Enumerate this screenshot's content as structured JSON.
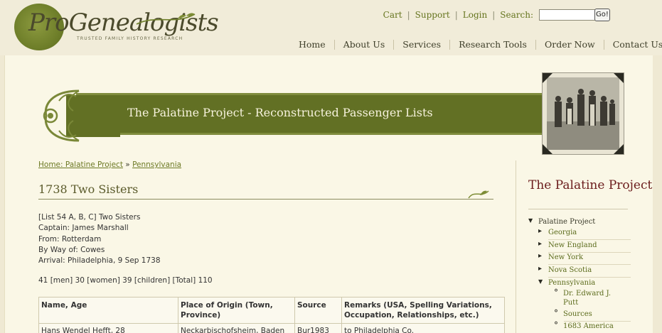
{
  "logo": {
    "script": "ProGenealogists",
    "tagline": "TRUSTED FAMILY HISTORY RESEARCH"
  },
  "util_nav": {
    "cart": "Cart",
    "support": "Support",
    "login": "Login",
    "search_label": "Search:",
    "search_value": "",
    "go": "Go!"
  },
  "main_nav": [
    "Home",
    "About Us",
    "Services",
    "Research Tools",
    "Order Now",
    "Contact Us"
  ],
  "banner": {
    "title": "The Palatine Project - Reconstructed Passenger Lists"
  },
  "breadcrumb": {
    "home": "Home: Palatine Project",
    "sep": "»",
    "current": "Pennsylvania"
  },
  "page": {
    "title": "1738 Two Sisters",
    "info": [
      "[List 54 A, B, C] Two Sisters",
      "Captain: James Marshall",
      "From: Rotterdam",
      "By Way of: Cowes",
      "Arrival: Philadelphia, 9 Sep 1738"
    ],
    "counts": "41 [men] 30 [women] 39 [children] [Total] 110"
  },
  "table": {
    "headers": [
      "Name, Age",
      "Place of Origin (Town, Province)",
      "Source",
      "Remarks (USA, Spelling Variations, Occupation, Relationships, etc.)"
    ],
    "rows": [
      [
        "Hans Wendel Hefft, 28",
        "Neckarbischofsheim, Baden",
        "Bur1983",
        "to Philadelphia Co."
      ]
    ]
  },
  "sidebar": {
    "title": "The Palatine Project",
    "items": [
      {
        "label": "Palatine Project",
        "level": 0,
        "bullet": "▼"
      },
      {
        "label": "Georgia",
        "level": 1,
        "bullet": "▸"
      },
      {
        "label": "New England",
        "level": 1,
        "bullet": "▸"
      },
      {
        "label": "New York",
        "level": 1,
        "bullet": "▸"
      },
      {
        "label": "Nova Scotia",
        "level": 1,
        "bullet": "▸"
      },
      {
        "label": "Pennsylvania",
        "level": 1,
        "bullet": "▼"
      },
      {
        "label": "Dr. Edward J.",
        "level": 2,
        "bullet": "°"
      },
      {
        "label": "Putt",
        "level": 2,
        "bullet": ""
      },
      {
        "label": "Sources",
        "level": 2,
        "bullet": "°"
      },
      {
        "label": "1683 America",
        "level": 2,
        "bullet": "°"
      }
    ]
  },
  "colors": {
    "accent_green": "#627024",
    "link_green": "#6d7a25",
    "sidebar_title": "#6b1c1c"
  }
}
